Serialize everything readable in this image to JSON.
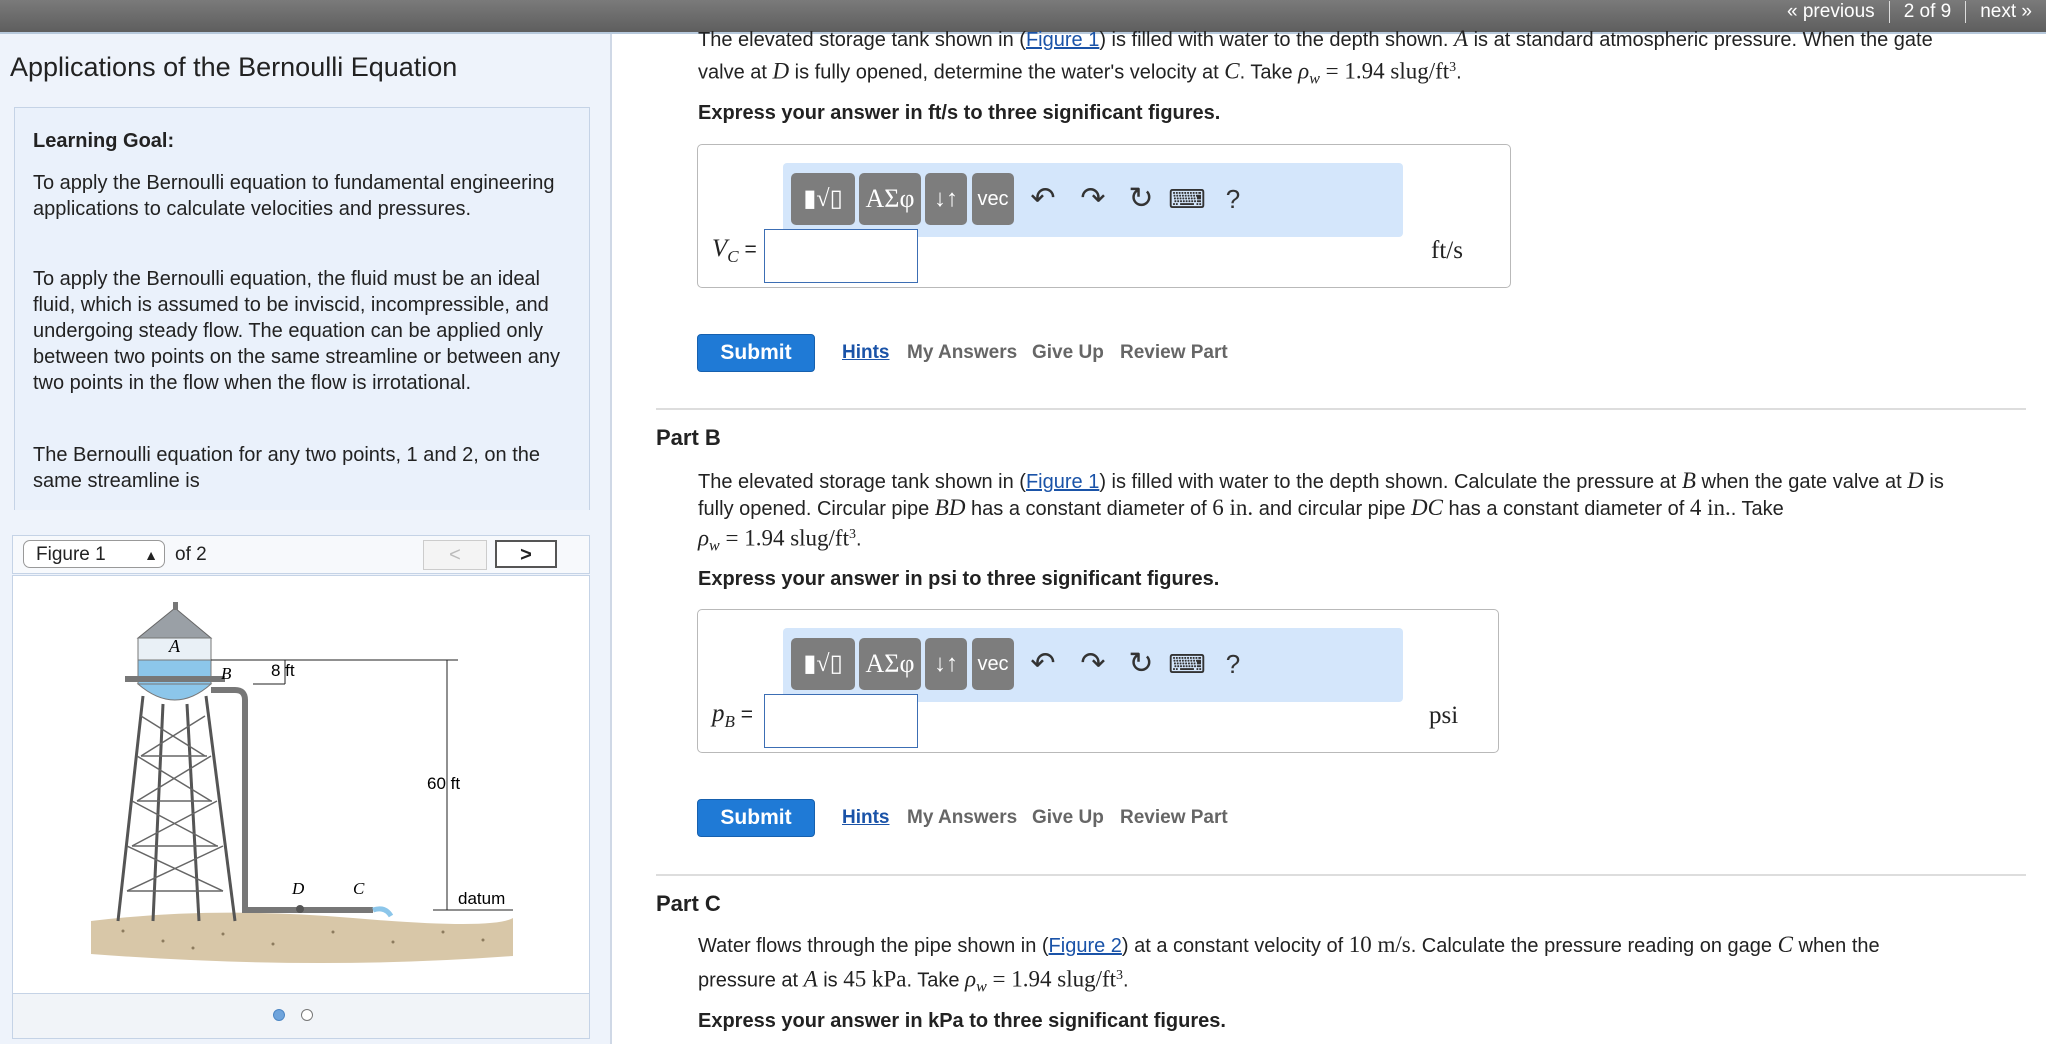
{
  "nav": {
    "previous": "« previous",
    "position": "2 of 9",
    "next": "next »"
  },
  "sidebar": {
    "title": "Applications of the Bernoulli Equation",
    "goal_heading": "Learning Goal:",
    "goal_p1": "To apply the Bernoulli equation to fundamental engineering applications to calculate velocities and pressures.",
    "goal_p2": "To apply the Bernoulli equation, the fluid must be an ideal fluid, which is assumed to be inviscid, incompressible, and undergoing steady flow. The equation can be applied only between two points on the same streamline or between any two points in the flow when the flow is irrotational.",
    "goal_p3": "The Bernoulli equation for any two points, 1 and 2, on the same streamline is",
    "figure_select": "Figure 1",
    "figure_of": "of 2",
    "figure_prev": "<",
    "figure_next": ">",
    "figure_labels": {
      "a": "A",
      "b": "B",
      "depth": "8 ft",
      "height": "60 ft",
      "d": "D",
      "c": "C",
      "datum": "datum"
    }
  },
  "colors": {
    "accent": "#1f7ad6",
    "link": "#1a53a8",
    "toolbar_bg": "#d4e6fb",
    "sidebar_bg": "#eef3fb",
    "dot_active": "#6fa4dc"
  },
  "toolbar": {
    "templates": "▮√▯",
    "greek": "ΑΣφ",
    "arrows": "↓↑",
    "vec": "vec",
    "undo": "↶",
    "redo": "↷",
    "reset": "↻",
    "keyboard": "⌨",
    "help": "?"
  },
  "actions": {
    "submit": "Submit",
    "hints": "Hints",
    "my_answers": "My Answers",
    "give_up": "Give Up",
    "review": "Review Part"
  },
  "partA": {
    "q_line1_a": "The elevated storage tank shown in (",
    "q_line1_link": "Figure 1",
    "q_line1_b": ") is filled with water to the depth shown. ",
    "q_line1_c": " is at standard atmospheric pressure. When the gate",
    "q_line2_a": "valve at ",
    "q_line2_b": " is fully opened, determine the water's velocity at ",
    "q_line2_c": ". Take ",
    "sym_A": "A",
    "sym_D": "D",
    "sym_C": "C",
    "rho": "ρ",
    "rho_sub": "w",
    "rho_val": " = 1.94 slug/ft",
    "express": "Express your answer in ft/s to three significant figures.",
    "var": "V",
    "var_sub": "C",
    "eq": " =",
    "unit": "ft/s"
  },
  "partB": {
    "heading": "Part B",
    "q_line1_a": "The elevated storage tank shown in (",
    "q_line1_link": "Figure 1",
    "q_line1_b": ") is filled with water to the depth shown. Calculate the pressure at ",
    "q_line1_c": " when the gate valve at ",
    "q_line1_d": " is",
    "q_line2_a": "fully opened. Circular pipe ",
    "q_line2_b": " has a constant diameter of ",
    "q_line2_c": " and circular pipe ",
    "q_line2_d": " has a constant diameter of ",
    "q_line2_e": ". Take",
    "sym_B": "B",
    "sym_D": "D",
    "sym_BD": "BD",
    "sym_DC": "DC",
    "d1": "6 in.",
    "d2": "4 in.",
    "rho": "ρ",
    "rho_sub": "w",
    "rho_val": " = 1.94 slug/ft",
    "express": "Express your answer in psi to three significant figures.",
    "var": "p",
    "var_sub": "B",
    "eq": " =",
    "unit": "psi"
  },
  "partC": {
    "heading": "Part C",
    "q_line1_a": "Water flows through the pipe shown in (",
    "q_line1_link": "Figure 2",
    "q_line1_b": ") at a constant velocity of ",
    "q_line1_v": "10 m/s",
    "q_line1_c": ". Calculate the pressure reading on gage ",
    "q_line1_d": " when the",
    "q_line2_a": "pressure at ",
    "q_line2_b": " is ",
    "q_line2_p": "45 kPa",
    "q_line2_c": ". Take ",
    "sym_C": "C",
    "sym_A": "A",
    "rho": "ρ",
    "rho_sub": "w",
    "rho_val": " = 1.94 slug/ft",
    "express": "Express your answer in kPa to three significant figures."
  },
  "superscript_3": "3",
  "period": "."
}
